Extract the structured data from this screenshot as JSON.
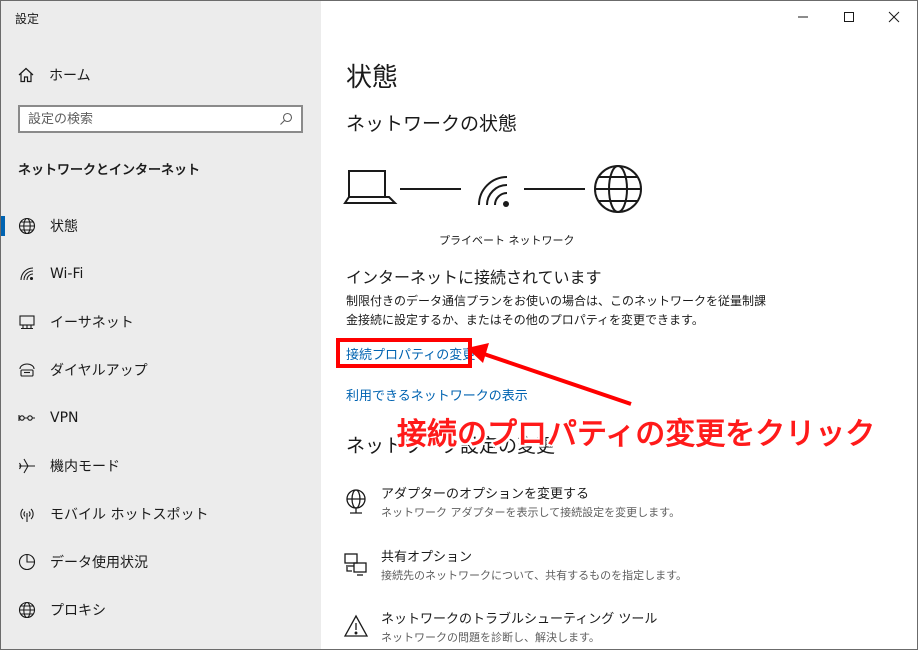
{
  "window": {
    "title": "設定",
    "controls": [
      "minimize-icon",
      "maximize-icon",
      "close-icon"
    ]
  },
  "sidebar": {
    "home_label": "ホーム",
    "search": {
      "placeholder": "設定の検索",
      "value": ""
    },
    "section_heading": "ネットワークとインターネット",
    "items": [
      {
        "label": "状態",
        "icon": "globe-icon",
        "active": true
      },
      {
        "label": "Wi-Fi",
        "icon": "wifi-icon",
        "active": false
      },
      {
        "label": "イーサネット",
        "icon": "ethernet-icon",
        "active": false
      },
      {
        "label": "ダイヤルアップ",
        "icon": "dialup-icon",
        "active": false
      },
      {
        "label": "VPN",
        "icon": "vpn-icon",
        "active": false
      },
      {
        "label": "機内モード",
        "icon": "airplane-icon",
        "active": false
      },
      {
        "label": "モバイル ホットスポット",
        "icon": "hotspot-icon",
        "active": false
      },
      {
        "label": "データ使用状況",
        "icon": "data-usage-icon",
        "active": false
      },
      {
        "label": "プロキシ",
        "icon": "globe-icon",
        "active": false
      }
    ]
  },
  "main": {
    "page_title": "状態",
    "network_status_heading": "ネットワークの状態",
    "network_label": "プライベート ネットワーク",
    "connection_status": "インターネットに接続されています",
    "description": "制限付きのデータ通信プランをお使いの場合は、このネットワークを従量制課金接続に設定するか、またはその他のプロパティを変更できます。",
    "link_change_properties": "接続プロパティの変更",
    "link_show_networks": "利用できるネットワークの表示",
    "settings_heading": "ネットワーク設定の変更",
    "options": [
      {
        "title": "アダプターのオプションを変更する",
        "subtitle": "ネットワーク アダプターを表示して接続設定を変更します。",
        "icon": "adapter-icon"
      },
      {
        "title": "共有オプション",
        "subtitle": "接続先のネットワークについて、共有するものを指定します。",
        "icon": "sharing-icon"
      },
      {
        "title": "ネットワークのトラブルシューティング ツール",
        "subtitle": "ネットワークの問題を診断し、解決します。",
        "icon": "warning-icon"
      }
    ]
  },
  "annotation": {
    "text": "接続のプロパティの変更をクリック",
    "color": "#ff0000"
  },
  "colors": {
    "accent": "#0063b1",
    "sidebar_bg": "#ececec"
  }
}
